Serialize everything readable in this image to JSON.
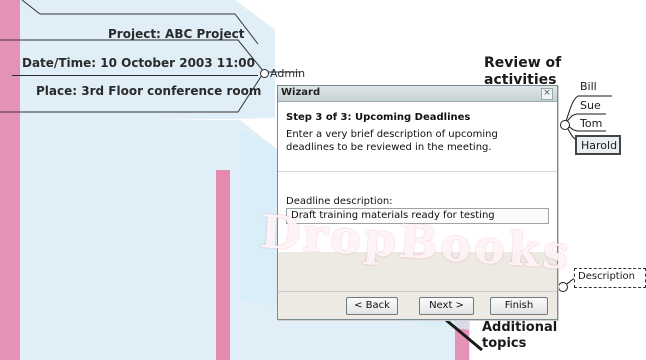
{
  "mindmap": {
    "project": "Project: ABC Project",
    "datetime": "Date/Time: 10 October 2003 11:00",
    "place": "Place: 3rd Floor conference room",
    "admin": "Admin",
    "review_title_line1": "Review of",
    "review_title_line2": "activities",
    "names": [
      "Bill",
      "Sue",
      "Tom",
      "Harold"
    ],
    "description": "Description",
    "additional_line1": "Additional",
    "additional_line2": "topics"
  },
  "watermark": {
    "text": "DropBooks"
  },
  "dialog": {
    "window_title": "Wizard",
    "close_symbol": "×",
    "step_title": "Step 3 of 3: Upcoming Deadlines",
    "step_description": "Enter a very brief description of upcoming deadlines to be reviewed in the meeting.",
    "field_label": "Deadline description:",
    "field_value": "Draft training materials ready for testing",
    "back_label": "< Back",
    "next_label": "Next >",
    "finish_label": "Finish"
  },
  "colors": {
    "bg_hex_fill": "#dfeef6",
    "watermark_stripe": "#e7467f"
  }
}
